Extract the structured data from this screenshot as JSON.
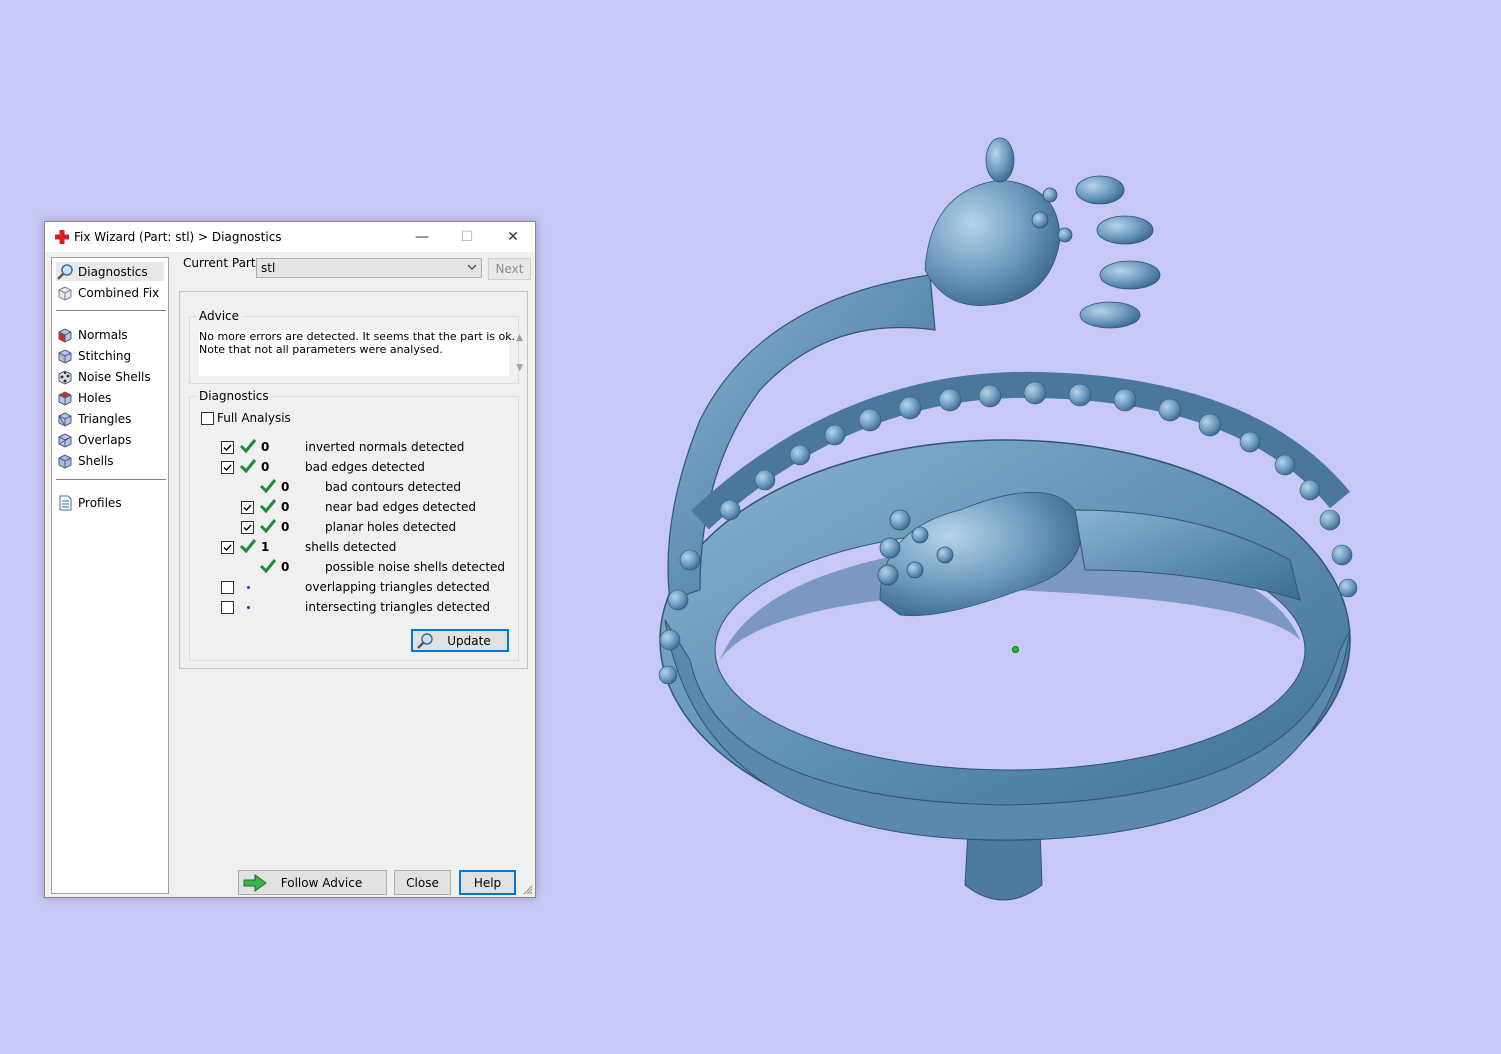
{
  "window": {
    "title": "Fix Wizard (Part: stl) > Diagnostics",
    "min_glyph": "—",
    "max_glyph": "☐",
    "close_glyph": "✕"
  },
  "sidebar": {
    "items": [
      {
        "label": "Diagnostics",
        "icon": "magnifier-icon",
        "selected": true
      },
      {
        "label": "Combined Fix",
        "icon": "combined-fix-icon"
      },
      {
        "label": "Normals",
        "icon": "normals-cube-icon"
      },
      {
        "label": "Stitching",
        "icon": "stitching-cube-icon"
      },
      {
        "label": "Noise Shells",
        "icon": "noise-shells-icon"
      },
      {
        "label": "Holes",
        "icon": "holes-cube-icon"
      },
      {
        "label": "Triangles",
        "icon": "triangles-cube-icon"
      },
      {
        "label": "Overlaps",
        "icon": "overlaps-cube-icon"
      },
      {
        "label": "Shells",
        "icon": "shells-cube-icon"
      },
      {
        "label": "Profiles",
        "icon": "profiles-document-icon"
      }
    ]
  },
  "header": {
    "current_part_label": "Current Part:",
    "current_part_value": "stl",
    "next_label": "Next"
  },
  "advice": {
    "title": "Advice",
    "lines": [
      "No more errors are detected. It seems that the part is ok.",
      "Note that not all parameters were analysed."
    ]
  },
  "diagnostics": {
    "title": "Diagnostics",
    "full_analysis_label": "Full Analysis",
    "full_analysis_checked": false,
    "rows": [
      {
        "count": "0",
        "label": "inverted normals detected",
        "checked": true
      },
      {
        "count": "0",
        "label": "bad edges detected",
        "checked": true
      },
      {
        "count": "0",
        "label": "bad contours detected"
      },
      {
        "count": "0",
        "label": "near bad edges detected",
        "checked": true
      },
      {
        "count": "0",
        "label": "planar holes detected",
        "checked": true
      },
      {
        "count": "1",
        "label": "shells detected",
        "checked": true
      },
      {
        "count": "0",
        "label": "possible noise shells detected"
      },
      {
        "count": "",
        "label": "overlapping triangles detected",
        "checked": false
      },
      {
        "count": "",
        "label": "intersecting triangles detected",
        "checked": false
      }
    ],
    "update_label": "Update"
  },
  "footer": {
    "follow_advice_label": "Follow Advice",
    "close_label": "Close",
    "help_label": "Help"
  },
  "colors": {
    "viewport_background": "#c8c8f8",
    "model_color": "#5e8db0",
    "check_green": "#1e8a3a",
    "app_icon_red": "#d42020"
  }
}
